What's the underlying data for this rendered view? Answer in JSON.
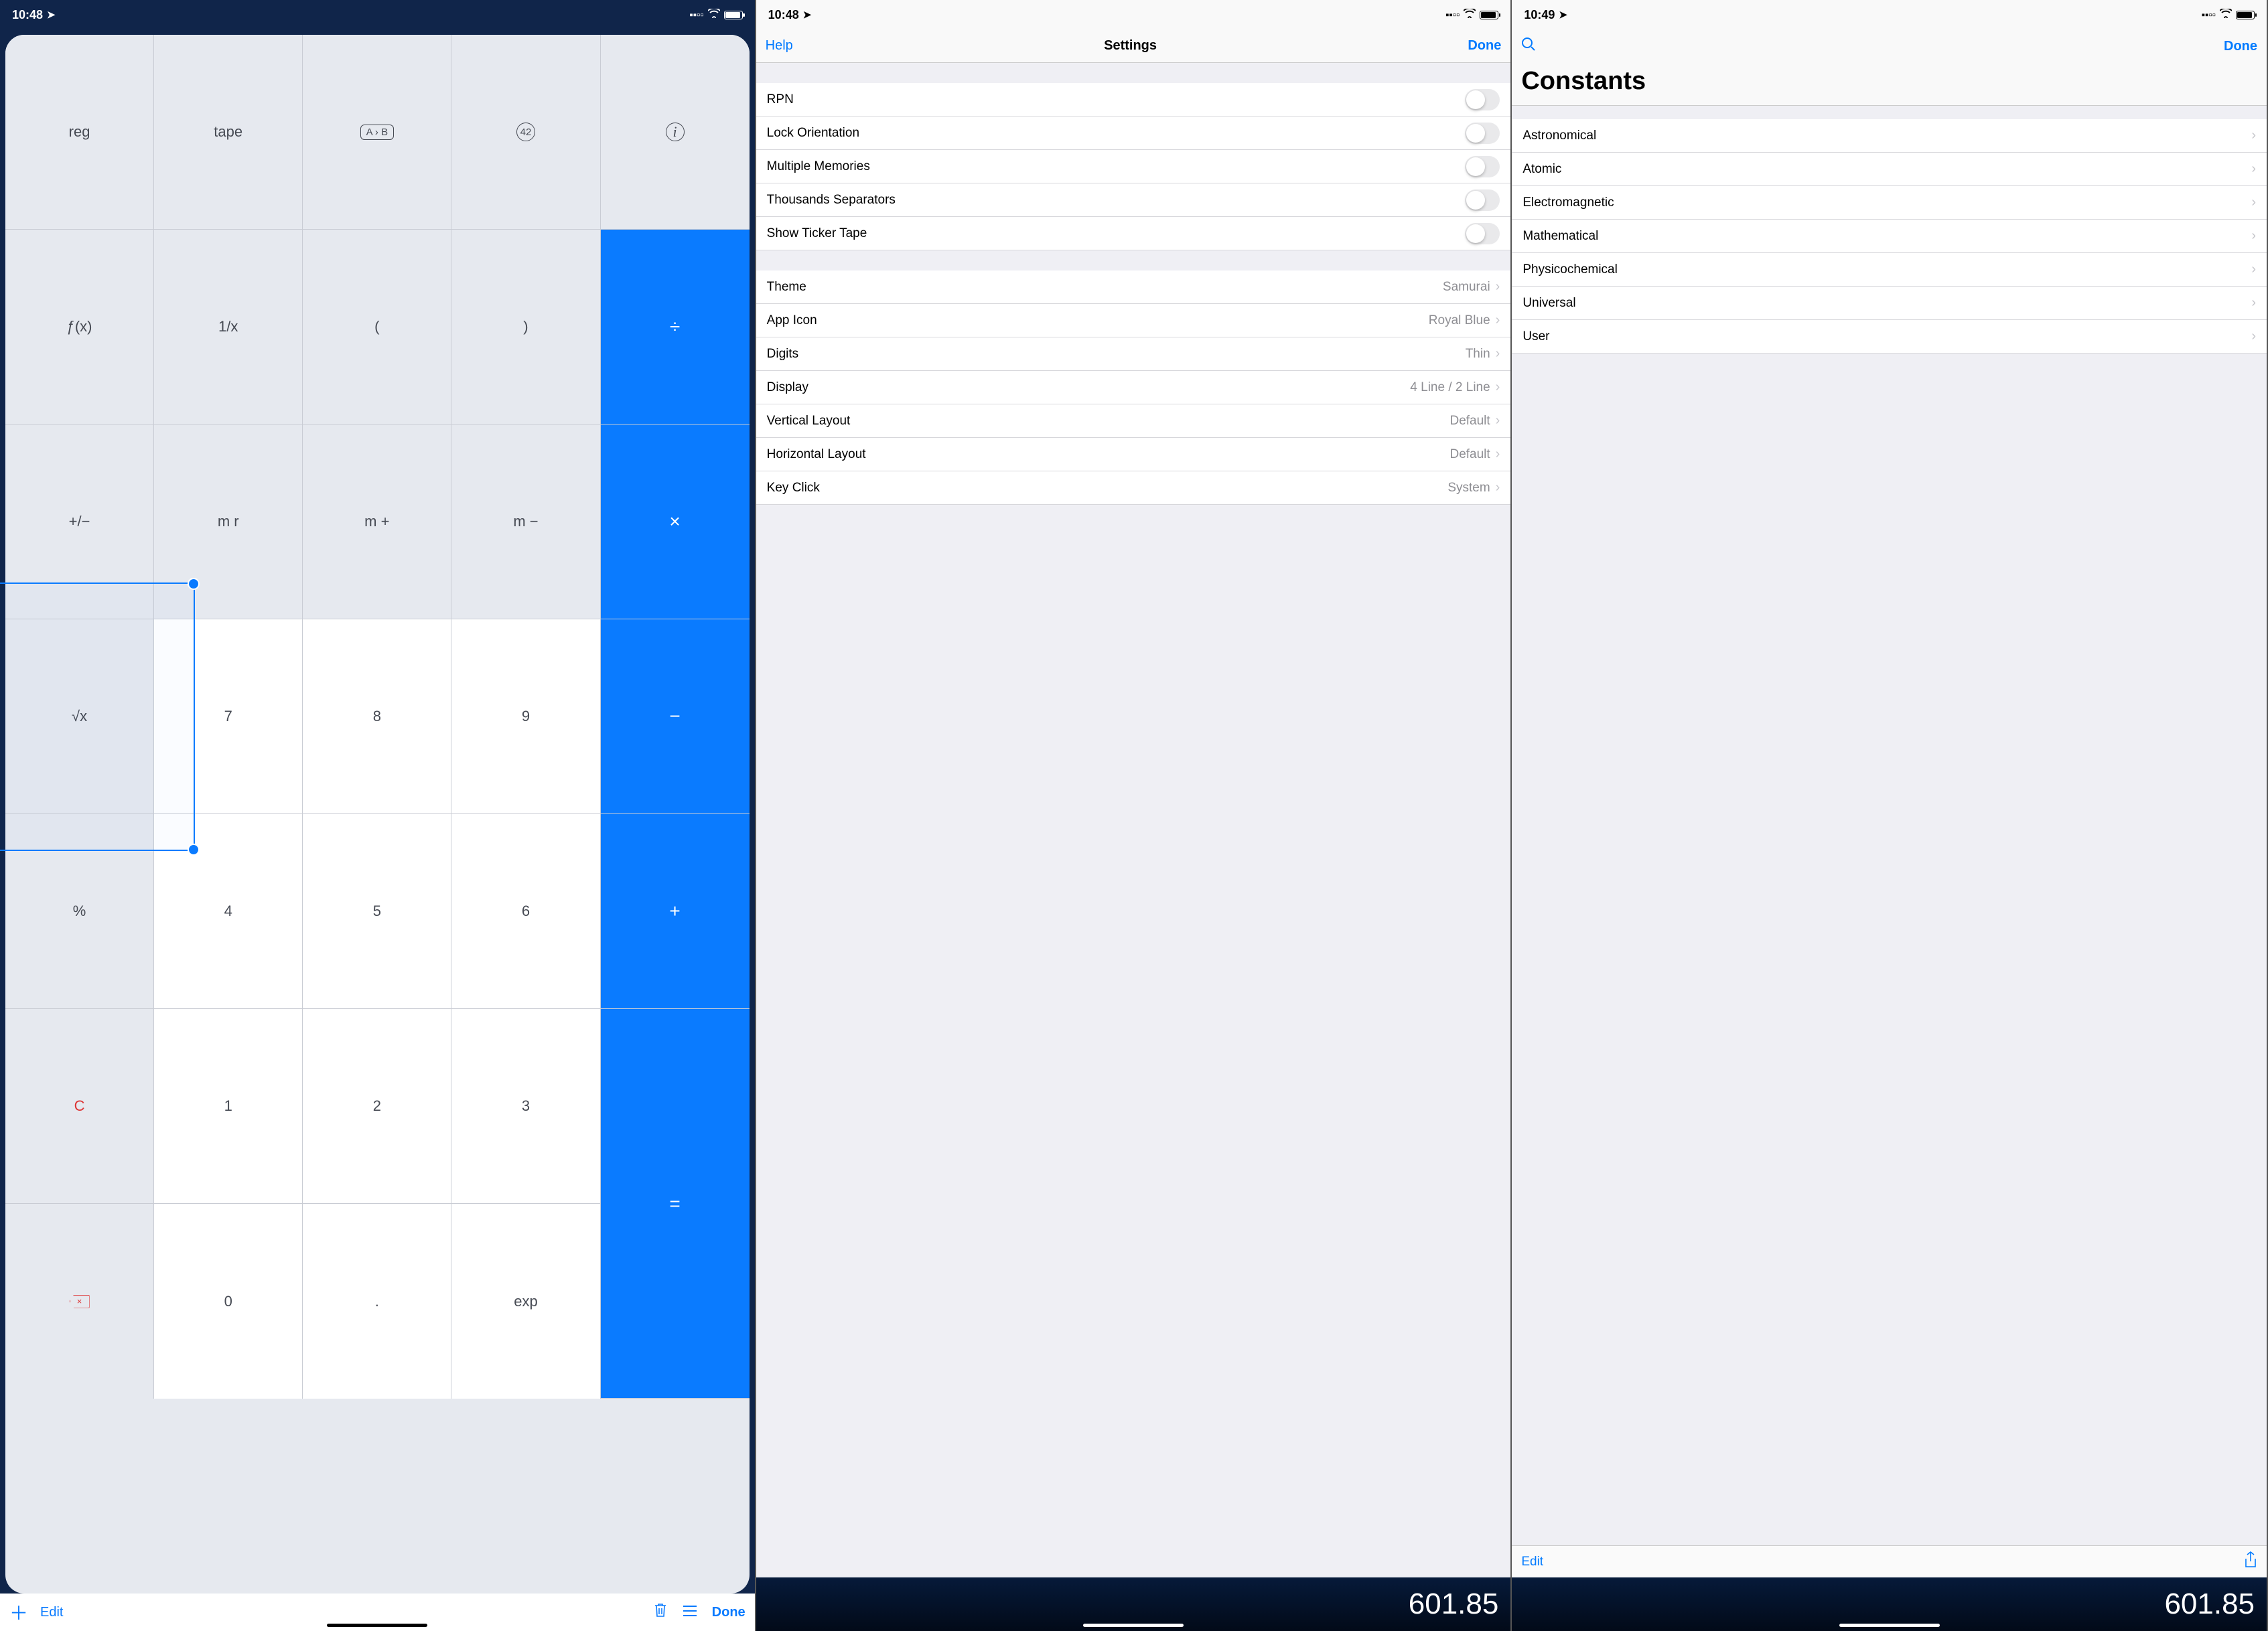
{
  "screen1": {
    "statusbar": {
      "time": "10:48"
    },
    "keypad": {
      "r1": [
        "reg",
        "tape",
        "A › B",
        "42",
        "i"
      ],
      "r2": [
        "ƒ(x)",
        "1/x",
        "(",
        ")",
        "÷"
      ],
      "r3": [
        "+/−",
        "m r",
        "m +",
        "m −",
        "×"
      ],
      "r4": [
        "√x",
        "7",
        "8",
        "9",
        "−"
      ],
      "r5": [
        "%",
        "4",
        "5",
        "6",
        "+"
      ],
      "r6": [
        "C",
        "1",
        "2",
        "3",
        "="
      ],
      "r7": [
        "⌫",
        "0",
        ".",
        "exp",
        "="
      ]
    },
    "toolbar": {
      "edit": "Edit",
      "done": "Done"
    }
  },
  "screen2": {
    "statusbar": {
      "time": "10:48"
    },
    "nav": {
      "help": "Help",
      "title": "Settings",
      "done": "Done"
    },
    "toggles": [
      {
        "label": "RPN"
      },
      {
        "label": "Lock Orientation"
      },
      {
        "label": "Multiple Memories"
      },
      {
        "label": "Thousands Separators"
      },
      {
        "label": "Show Ticker Tape"
      }
    ],
    "rows": [
      {
        "label": "Theme",
        "value": "Samurai"
      },
      {
        "label": "App Icon",
        "value": "Royal Blue"
      },
      {
        "label": "Digits",
        "value": "Thin"
      },
      {
        "label": "Display",
        "value": "4 Line / 2 Line"
      },
      {
        "label": "Vertical Layout",
        "value": "Default"
      },
      {
        "label": "Horizontal Layout",
        "value": "Default"
      },
      {
        "label": "Key Click",
        "value": "System"
      }
    ],
    "display": "601.85"
  },
  "screen3": {
    "statusbar": {
      "time": "10:49"
    },
    "nav": {
      "done": "Done"
    },
    "title": "Constants",
    "categories": [
      "Astronomical",
      "Atomic",
      "Electromagnetic",
      "Mathematical",
      "Physicochemical",
      "Universal",
      "User"
    ],
    "toolbar": {
      "edit": "Edit"
    },
    "display": "601.85"
  }
}
